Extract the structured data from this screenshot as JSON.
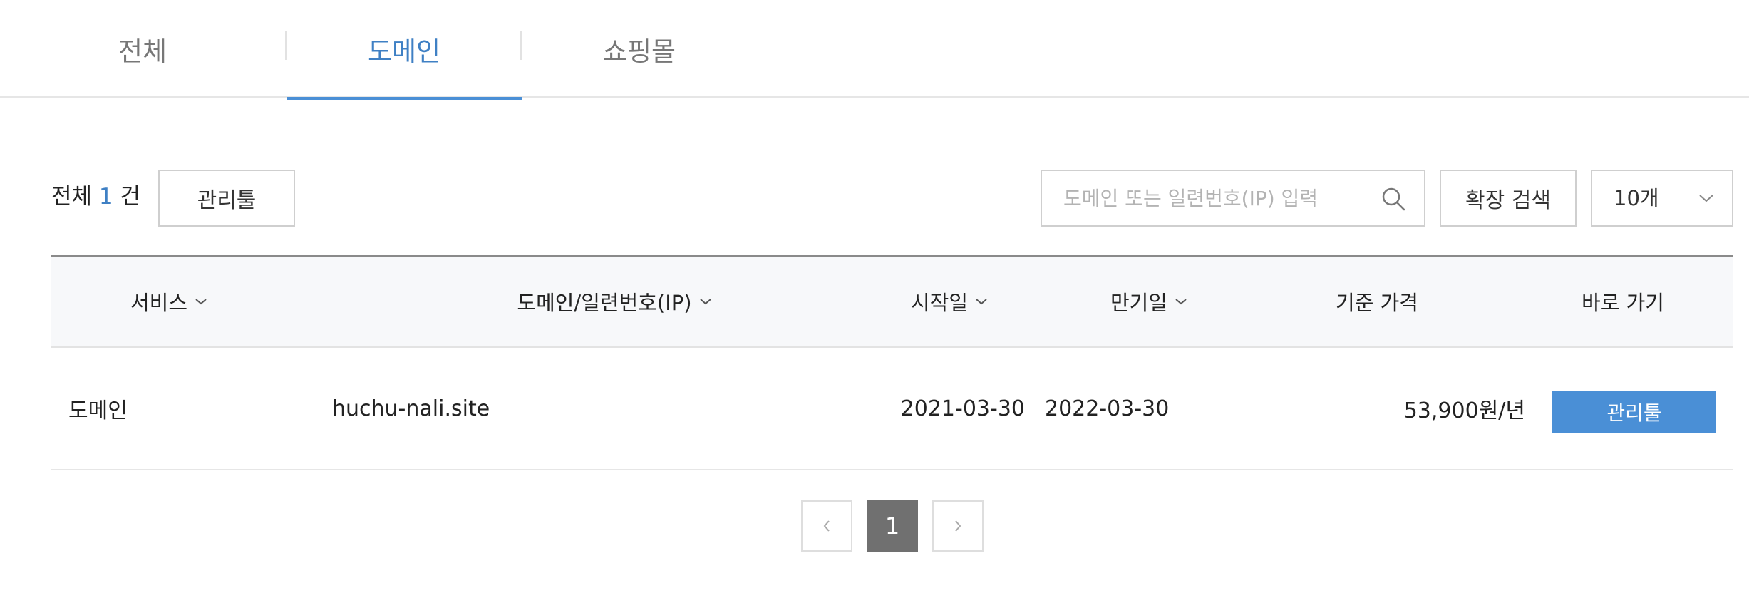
{
  "tabs": [
    {
      "label": "전체",
      "active": false
    },
    {
      "label": "도메인",
      "active": true
    },
    {
      "label": "쇼핑몰",
      "active": false
    }
  ],
  "toolbar": {
    "total_prefix": "전체",
    "total_count": "1",
    "total_suffix": "건",
    "manage_tool_label": "관리툴",
    "search_placeholder": "도메인 또는 일련번호(IP) 입력",
    "search_value": "",
    "extended_search_label": "확장 검색",
    "page_size_value": "10개"
  },
  "table": {
    "columns": [
      {
        "label": "서비스",
        "sortable": true
      },
      {
        "label": "도메인/일련번호(IP)",
        "sortable": true
      },
      {
        "label": "시작일",
        "sortable": true
      },
      {
        "label": "만기일",
        "sortable": true
      },
      {
        "label": "기준 가격",
        "sortable": false
      },
      {
        "label": "바로 가기",
        "sortable": false
      }
    ],
    "rows": [
      {
        "service": "도메인",
        "domain": "huchu-nali.site",
        "start_date": "2021-03-30",
        "expire_date": "2022-03-30",
        "price": "53,900원/년",
        "shortcut_label": "관리툴"
      }
    ]
  },
  "pagination": {
    "current_page": "1"
  },
  "colors": {
    "accent": "#4a8fd6",
    "accent_text": "#3f80c4",
    "pager_active": "#707070",
    "header_bg": "#f7f8fa"
  },
  "icons": {
    "search": "search-icon",
    "sort": "chevron-down-icon",
    "select": "chevron-down-icon",
    "prev": "chevron-left-icon",
    "next": "chevron-right-icon"
  }
}
